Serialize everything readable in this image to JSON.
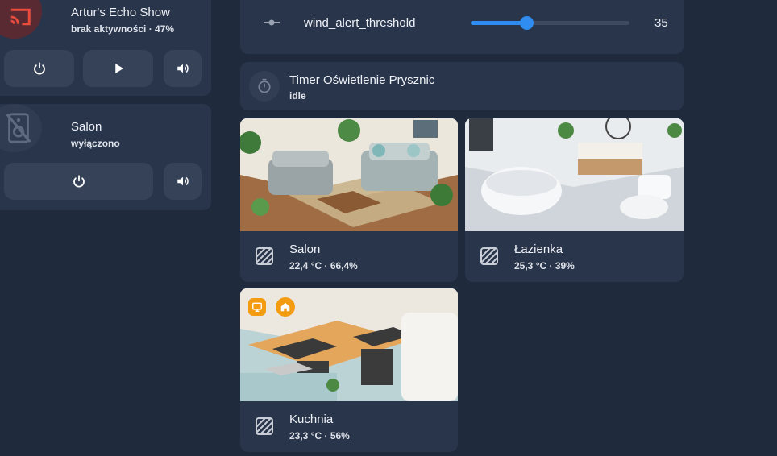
{
  "devices": [
    {
      "name": "Artur's Echo Show",
      "status": "brak aktywności · 47%",
      "icon": "cast-icon",
      "accent": "#e74c3c"
    },
    {
      "name": "Salon",
      "status": "wyłączono",
      "icon": "speaker-off-icon"
    }
  ],
  "slider": {
    "label": "wind_alert_threshold",
    "value": "35",
    "fill_fraction": 0.35,
    "accent": "#2f8cf0"
  },
  "timer": {
    "name": "Timer Oświetlenie Prysznic",
    "state": "idle"
  },
  "areas": [
    {
      "name": "Salon",
      "stats": "22,4 °C · 66,4%"
    },
    {
      "name": "Łazienka",
      "stats": "25,3 °C · 39%"
    },
    {
      "name": "Kuchnia",
      "stats": "23,3 °C · 56%",
      "badge_colors": [
        "#f39c12",
        "#f39c12"
      ]
    }
  ]
}
